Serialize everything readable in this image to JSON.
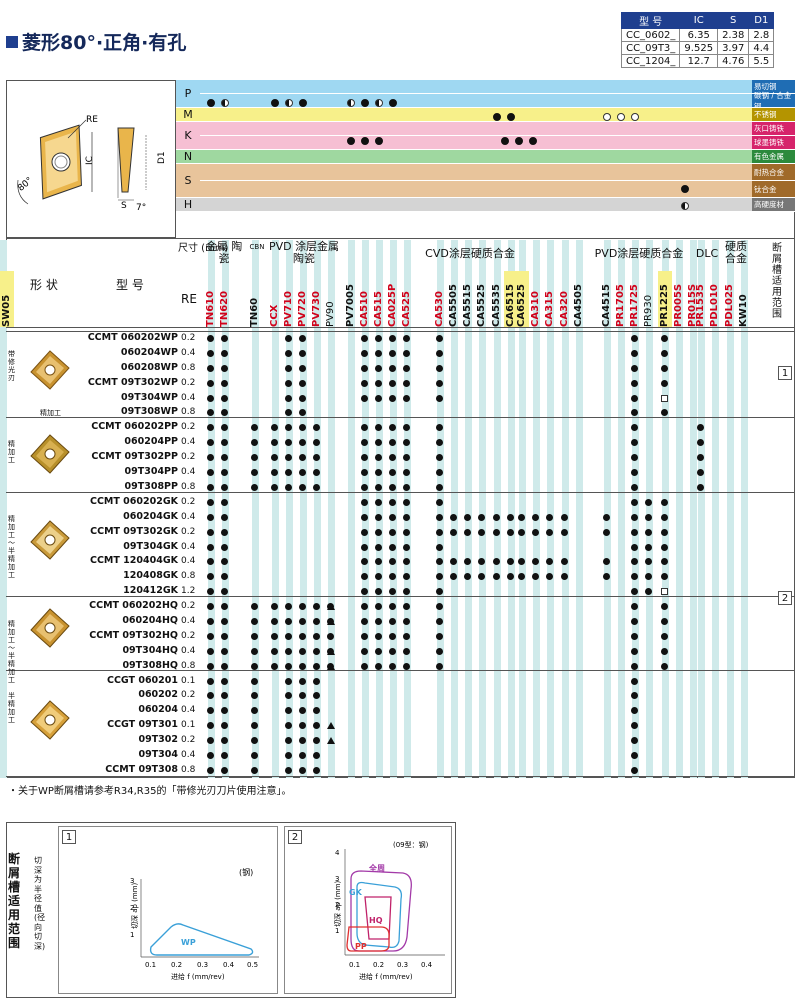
{
  "title": "菱形80°·正角·有孔",
  "dim_table": {
    "headers": [
      "型 号",
      "IC",
      "S",
      "D1"
    ],
    "rows": [
      [
        "CC_0602_",
        "6.35",
        "2.38",
        "2.8"
      ],
      [
        "CC_09T3_",
        "9.525",
        "3.97",
        "4.4"
      ],
      [
        "CC_1204_",
        "12.7",
        "4.76",
        "5.5"
      ]
    ]
  },
  "diagram": {
    "re": "RE",
    "ic": "IC",
    "d1": "D1",
    "s": "S",
    "angle80": "80°",
    "angle7": "7°"
  },
  "materials": [
    {
      "code": "P",
      "color": "#9fd8f2",
      "bands": [
        {
          "label": "易切钢",
          "color": "#9fd8f2",
          "lc": "#1f6db4"
        },
        {
          "label": "碳钢 / 合金钢",
          "color": "#9fd8f2",
          "lc": "#1f6db4"
        }
      ]
    },
    {
      "code": "M",
      "color": "#f7f08a",
      "bands": [
        {
          "label": "不锈钢",
          "color": "#f7f08a",
          "lc": "#b49400"
        }
      ]
    },
    {
      "code": "K",
      "color": "#f6bfd3",
      "bands": [
        {
          "label": "灰口铸铁",
          "color": "#f6bfd3",
          "lc": "#d6246b"
        },
        {
          "label": "球墨铸铁",
          "color": "#f6bfd3",
          "lc": "#d6246b"
        }
      ]
    },
    {
      "code": "N",
      "color": "#9fd8a0",
      "bands": [
        {
          "label": "有色金属",
          "color": "#9fd8a0",
          "lc": "#2c8a3c"
        }
      ]
    },
    {
      "code": "S",
      "color": "#e8c49b",
      "bands": [
        {
          "label": "耐热合金",
          "color": "#e8c49b",
          "lc": "#a06a2a"
        },
        {
          "label": "钛合金",
          "color": "#e8c49b",
          "lc": "#a06a2a"
        }
      ]
    },
    {
      "code": "H",
      "color": "#d4d4d4",
      "bands": [
        {
          "label": "高硬度材",
          "color": "#d4d4d4",
          "lc": "#777"
        }
      ]
    }
  ],
  "header": {
    "shape": "形 状",
    "type": "型 号",
    "size": "尺寸 (mm)",
    "re": "RE",
    "break": "断屑槽适用范围",
    "groups": [
      {
        "label": "金属 陶瓷",
        "x": 204
      },
      {
        "label": "CVD涂层硬质合金",
        "x": 415
      },
      {
        "label": "PVD涂层硬质合金",
        "x": 588
      },
      {
        "label": "DLC",
        "x": 694
      },
      {
        "label": "硬质 合金",
        "x": 723
      }
    ],
    "pvd_group": "PVD 涂层金属陶瓷",
    "cbn_group": "CBN"
  },
  "grades": [
    {
      "name": "TN610",
      "c": "#d0021b"
    },
    {
      "name": "TN620",
      "c": "#d0021b"
    },
    {
      "name": "TN60",
      "c": "#111"
    },
    {
      "name": "CCX",
      "c": "#d0021b"
    },
    {
      "name": "PV710",
      "c": "#d0021b"
    },
    {
      "name": "PV720",
      "c": "#d0021b"
    },
    {
      "name": "PV730",
      "c": "#d0021b"
    },
    {
      "name": "PV90",
      "c": "#111",
      "light": true
    },
    {
      "name": "PV7005",
      "c": "#111"
    },
    {
      "name": "CA510",
      "c": "#d0021b"
    },
    {
      "name": "CA515",
      "c": "#d0021b"
    },
    {
      "name": "CA025P",
      "c": "#d0021b"
    },
    {
      "name": "CA525",
      "c": "#d0021b"
    },
    {
      "name": "CA530",
      "c": "#d0021b"
    },
    {
      "name": "CA5505",
      "c": "#111"
    },
    {
      "name": "CA5515",
      "c": "#111"
    },
    {
      "name": "CA5525",
      "c": "#111"
    },
    {
      "name": "CA5535",
      "c": "#111"
    },
    {
      "name": "CA6515",
      "c": "#111",
      "bg": "#f7f08a"
    },
    {
      "name": "CA6525",
      "c": "#111",
      "bg": "#f7f08a"
    },
    {
      "name": "CA310",
      "c": "#d0021b"
    },
    {
      "name": "CA315",
      "c": "#d0021b"
    },
    {
      "name": "CA320",
      "c": "#d0021b"
    },
    {
      "name": "CA4505",
      "c": "#111"
    },
    {
      "name": "CA4515",
      "c": "#111"
    },
    {
      "name": "PR1705",
      "c": "#d0021b"
    },
    {
      "name": "PR1725",
      "c": "#d0021b"
    },
    {
      "name": "PR930",
      "c": "#111",
      "light": true
    },
    {
      "name": "PR1225",
      "c": "#111",
      "bg": "#f7f08a"
    },
    {
      "name": "PR005S",
      "c": "#d0021b"
    },
    {
      "name": "PR015S",
      "c": "#d0021b"
    },
    {
      "name": "PR1535",
      "c": "#d0021b"
    },
    {
      "name": "PDL010",
      "c": "#d0021b"
    },
    {
      "name": "PDL025",
      "c": "#d0021b"
    },
    {
      "name": "KW10",
      "c": "#111"
    },
    {
      "name": "SW05",
      "c": "#111",
      "bg": "#f7f08a"
    }
  ],
  "section_labels": [
    {
      "label": "带修光刃",
      "sub": "精加工",
      "top": 330
    },
    {
      "label": "精加工",
      "sub": "",
      "top": 420
    },
    {
      "label": "精加工～半精加工",
      "sub": "",
      "top": 495
    },
    {
      "label": "精加工～半精加工",
      "sub": "",
      "top": 600
    },
    {
      "label": "半精加工",
      "sub": "",
      "top": 672
    }
  ],
  "rows": [
    {
      "t": "CCMT 060202WP",
      "re": "0.2"
    },
    {
      "t": "060204WP",
      "re": "0.4"
    },
    {
      "t": "060208WP",
      "re": "0.8"
    },
    {
      "t": "CCMT 09T302WP",
      "re": "0.2"
    },
    {
      "t": "09T304WP",
      "re": "0.4"
    },
    {
      "t": "09T308WP",
      "re": "0.8"
    },
    {
      "t": "CCMT 060202PP",
      "re": "0.2"
    },
    {
      "t": "060204PP",
      "re": "0.4"
    },
    {
      "t": "CCMT 09T302PP",
      "re": "0.2"
    },
    {
      "t": "09T304PP",
      "re": "0.4"
    },
    {
      "t": "09T308PP",
      "re": "0.8"
    },
    {
      "t": "CCMT 060202GK",
      "re": "0.2"
    },
    {
      "t": "060204GK",
      "re": "0.4"
    },
    {
      "t": "CCMT 09T302GK",
      "re": "0.2"
    },
    {
      "t": "09T304GK",
      "re": "0.4"
    },
    {
      "t": "CCMT 120404GK",
      "re": "0.4"
    },
    {
      "t": "120408GK",
      "re": "0.8"
    },
    {
      "t": "120412GK",
      "re": "1.2"
    },
    {
      "t": "CCMT 060202HQ",
      "re": "0.2"
    },
    {
      "t": "060204HQ",
      "re": "0.4"
    },
    {
      "t": "CCMT 09T302HQ",
      "re": "0.2"
    },
    {
      "t": "09T304HQ",
      "re": "0.4"
    },
    {
      "t": "09T308HQ",
      "re": "0.8"
    },
    {
      "t": "CCGT 060201",
      "re": "0.1"
    },
    {
      "t": "060202",
      "re": "0.2"
    },
    {
      "t": "060204",
      "re": "0.4"
    },
    {
      "t": "CCGT 09T301",
      "re": "0.1"
    },
    {
      "t": "09T302",
      "re": "0.2"
    },
    {
      "t": "09T304",
      "re": "0.4"
    },
    {
      "t": "CCMT 09T308",
      "re": "0.8"
    }
  ],
  "break_markers": [
    "1",
    "2"
  ],
  "note": "・关于WP断屑槽请参考R34,R35的「带修光刃刀片使用注意」。",
  "bottom": {
    "label": "断屑槽适用范围",
    "sublabel": "切深为半径值(径向切深)",
    "charts": [
      {
        "num": "1",
        "material": "(钢)",
        "xlabel": "进给 f (mm/rev)",
        "ylabel": "切深 ap (mm)",
        "xticks": [
          "0.1",
          "0.2",
          "0.3",
          "0.4",
          "0.5"
        ],
        "yticks": [
          "1",
          "2",
          "3"
        ],
        "regions": [
          "WP"
        ]
      },
      {
        "num": "2",
        "material": "(09型：钢)",
        "xlabel": "进给 f (mm/rev)",
        "ylabel": "切深 ap (mm)",
        "xticks": [
          "0.1",
          "0.2",
          "0.3",
          "0.4"
        ],
        "yticks": [
          "1",
          "2",
          "3",
          "4"
        ],
        "regions": [
          "全周",
          "GK",
          "HQ",
          "PP"
        ]
      }
    ]
  },
  "colors": {
    "navy": "#1f3f8f",
    "red": "#d0021b",
    "cyan_stripe": "#cfeaea",
    "gold": "#c8922f"
  }
}
